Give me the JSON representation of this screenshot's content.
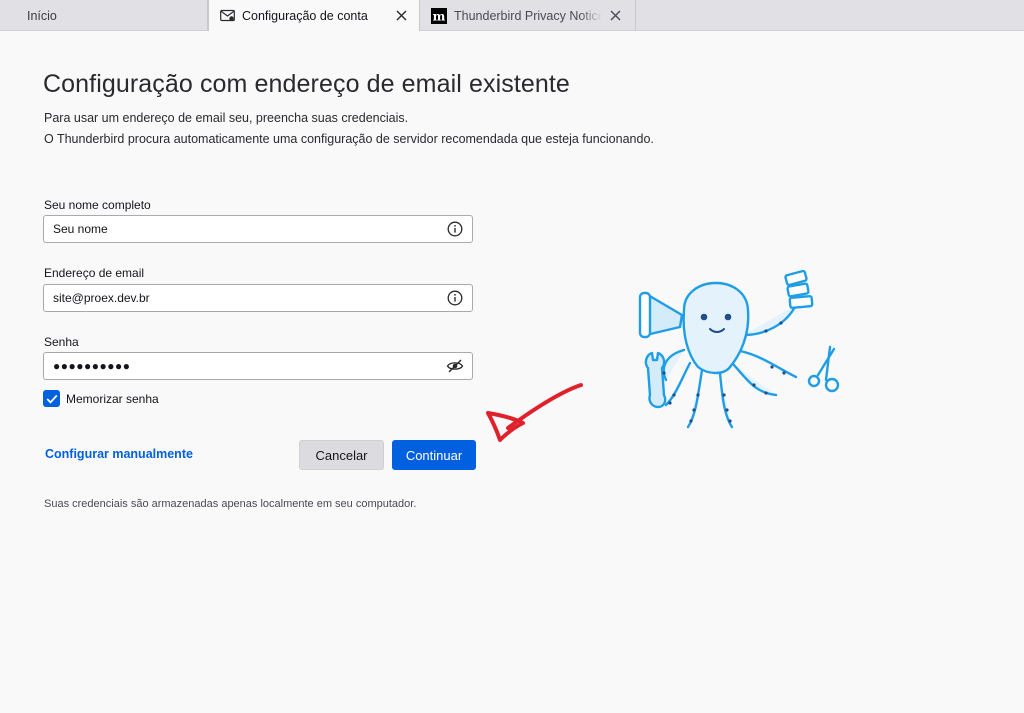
{
  "tabs": [
    {
      "label": "Início"
    },
    {
      "label": "Configuração de conta",
      "icon": "account-setup-icon"
    },
    {
      "label": "Thunderbird Privacy Notice",
      "icon": "mozilla-m-icon"
    }
  ],
  "page": {
    "title": "Configuração com endereço de email existente",
    "desc1": "Para usar um endereço de email seu, preencha suas credenciais.",
    "desc2": "O Thunderbird procura automaticamente uma configuração de servidor recomendada que esteja funcionando."
  },
  "form": {
    "name_label": "Seu nome completo",
    "name_value": "Seu nome",
    "email_label": "Endereço de email",
    "email_value": "site@proex.dev.br",
    "password_label": "Senha",
    "password_value": "●●●●●●●●●●",
    "remember_label": "Memorizar senha",
    "remember_checked": true
  },
  "actions": {
    "manual_link": "Configurar manualmente",
    "cancel": "Cancelar",
    "continue": "Continuar"
  },
  "footnote": "Suas credenciais são armazenadas apenas localmente em seu computador.",
  "colors": {
    "accent": "#0060df",
    "annotation": "#e0202a"
  }
}
